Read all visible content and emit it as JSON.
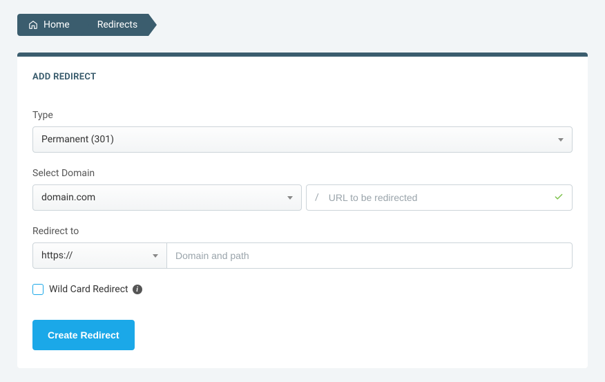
{
  "breadcrumb": {
    "home": "Home",
    "redirects": "Redirects"
  },
  "panel": {
    "title": "ADD REDIRECT"
  },
  "form": {
    "type_label": "Type",
    "type_value": "Permanent (301)",
    "domain_label": "Select Domain",
    "domain_value": "domain.com",
    "url_prefix": "/",
    "url_placeholder": "URL to be redirected",
    "url_value": "",
    "redirect_to_label": "Redirect to",
    "protocol_value": "https://",
    "path_placeholder": "Domain and path",
    "path_value": "",
    "wildcard_label": "Wild Card Redirect",
    "wildcard_checked": false,
    "submit_label": "Create Redirect"
  }
}
